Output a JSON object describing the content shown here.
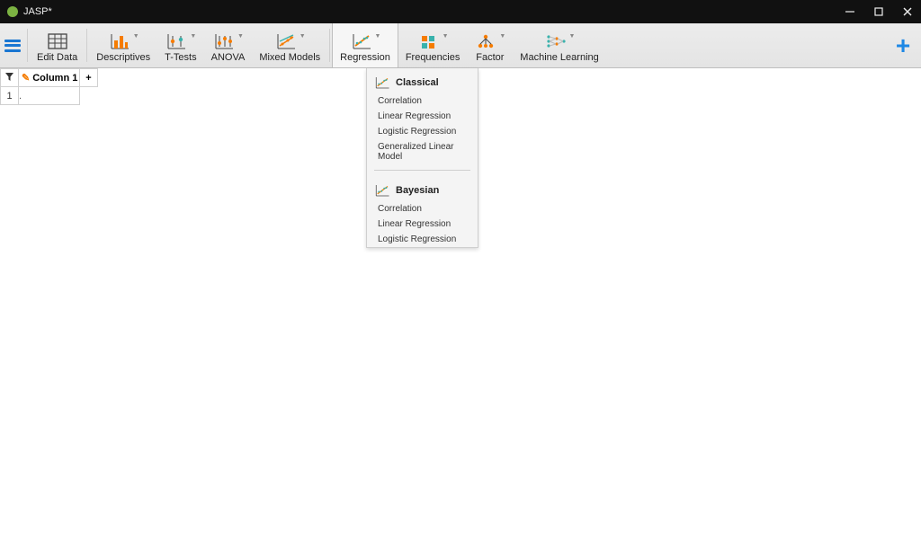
{
  "window": {
    "title": "JASP*"
  },
  "toolbar": {
    "active": "Regression",
    "items": [
      {
        "id": "edit-data",
        "label": "Edit Data",
        "chev": false
      },
      {
        "id": "descriptives",
        "label": "Descriptives",
        "chev": true
      },
      {
        "id": "t-tests",
        "label": "T-Tests",
        "chev": true
      },
      {
        "id": "anova",
        "label": "ANOVA",
        "chev": true
      },
      {
        "id": "mixed-models",
        "label": "Mixed Models",
        "chev": true
      },
      {
        "id": "regression",
        "label": "Regression",
        "chev": true
      },
      {
        "id": "frequencies",
        "label": "Frequencies",
        "chev": true
      },
      {
        "id": "factor",
        "label": "Factor",
        "chev": true
      },
      {
        "id": "machine-learning",
        "label": "Machine Learning",
        "chev": true
      }
    ]
  },
  "dropdown": {
    "sections": [
      {
        "header": "Classical",
        "items": [
          "Correlation",
          "Linear Regression",
          "Logistic Regression",
          "Generalized Linear Model"
        ]
      },
      {
        "header": "Bayesian",
        "items": [
          "Correlation",
          "Linear Regression",
          "Logistic Regression"
        ]
      }
    ]
  },
  "sheet": {
    "column_header": "Column 1",
    "rows": [
      {
        "num": "1",
        "value": "."
      }
    ]
  }
}
